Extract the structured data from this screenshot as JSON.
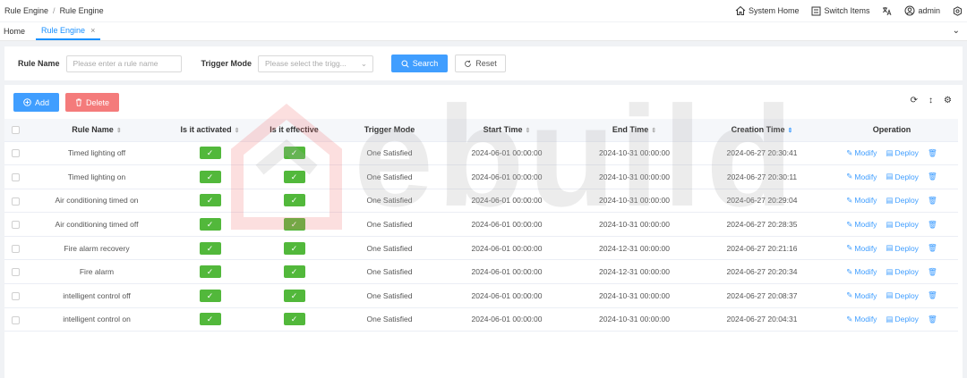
{
  "header": {
    "breadcrumb": [
      "Rule Engine",
      "Rule Engine"
    ],
    "breadcrumb_sep": "/",
    "system_home": "System Home",
    "switch_items": "Switch Items",
    "user": "admin"
  },
  "tabs": [
    {
      "label": "Home"
    },
    {
      "label": "Rule Engine",
      "close": "×"
    }
  ],
  "filter": {
    "rule_name_label": "Rule Name",
    "rule_name_placeholder": "Please enter a rule name",
    "trigger_mode_label": "Trigger Mode",
    "trigger_mode_placeholder": "Please select the trigg...",
    "search": "Search",
    "reset": "Reset"
  },
  "toolbar": {
    "add": "Add",
    "delete": "Delete"
  },
  "watermark": "ebuild",
  "table": {
    "headers": [
      "Rule Name",
      "Is it activated",
      "Is it effective",
      "Trigger Mode",
      "Start Time",
      "End Time",
      "Creation Time",
      "Operation"
    ],
    "rows": [
      {
        "name": "Timed lighting off",
        "mode": "One Satisfied",
        "start": "2024-06-01 00:00:00",
        "end": "2024-10-31 00:00:00",
        "created": "2024-06-27 20:30:41"
      },
      {
        "name": "Timed lighting on",
        "mode": "One Satisfied",
        "start": "2024-06-01 00:00:00",
        "end": "2024-10-31 00:00:00",
        "created": "2024-06-27 20:30:11"
      },
      {
        "name": "Air conditioning timed on",
        "mode": "One Satisfied",
        "start": "2024-06-01 00:00:00",
        "end": "2024-10-31 00:00:00",
        "created": "2024-06-27 20:29:04"
      },
      {
        "name": "Air conditioning timed off",
        "mode": "One Satisfied",
        "start": "2024-06-01 00:00:00",
        "end": "2024-10-31 00:00:00",
        "created": "2024-06-27 20:28:35"
      },
      {
        "name": "Fire alarm recovery",
        "mode": "One Satisfied",
        "start": "2024-06-01 00:00:00",
        "end": "2024-12-31 00:00:00",
        "created": "2024-06-27 20:21:16"
      },
      {
        "name": "Fire alarm",
        "mode": "One Satisfied",
        "start": "2024-06-01 00:00:00",
        "end": "2024-12-31 00:00:00",
        "created": "2024-06-27 20:20:34"
      },
      {
        "name": "intelligent control off",
        "mode": "One Satisfied",
        "start": "2024-06-01 00:00:00",
        "end": "2024-10-31 00:00:00",
        "created": "2024-06-27 20:08:37"
      },
      {
        "name": "intelligent control on",
        "mode": "One Satisfied",
        "start": "2024-06-01 00:00:00",
        "end": "2024-10-31 00:00:00",
        "created": "2024-06-27 20:04:31"
      }
    ],
    "modify": "Modify",
    "deploy": "Deploy"
  },
  "colors": {
    "primary": "#409eff",
    "danger": "#f47b7b",
    "success": "#52b83b"
  }
}
